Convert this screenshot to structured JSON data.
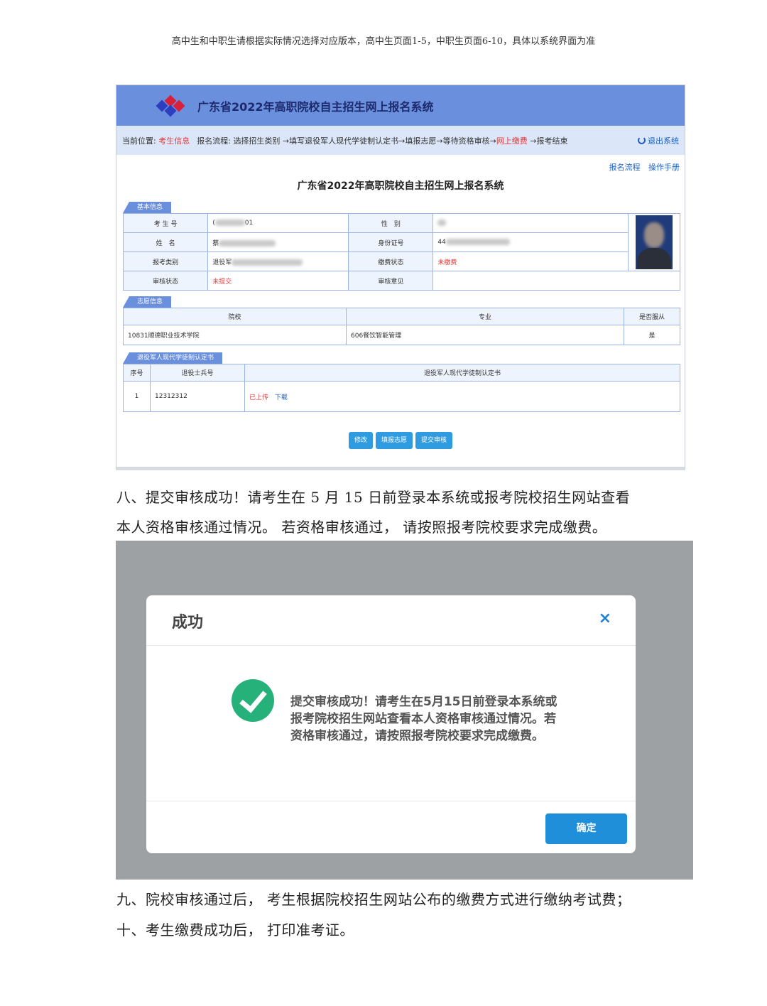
{
  "top_note": "高中生和中职生请根据实际情况选择对应版本，高中生页面1-5，中职生页面6-10，具体以系统界面为准",
  "system": {
    "title": "广东省2022年高职院校自主招生网上报名系统",
    "nav": {
      "position_label": "当前位置:",
      "position_value": "考生信息",
      "flow_label": "报名流程:",
      "flow_steps": "选择招生类别 →填写退役军人现代学徒制认定书→填报志愿→等待资格审核→",
      "flow_payment": "网上缴费",
      "flow_end": " →报考结束",
      "logout": "退出系统"
    },
    "links": [
      "报名流程",
      "操作手册"
    ],
    "page_heading": "广东省2022年高职院校自主招生网上报名系统",
    "basic": {
      "section": "基本信息",
      "labels": [
        "考 生 号",
        "性　别",
        "姓　名",
        "身份证号",
        "报考类别",
        "缴费状态",
        "审核状态",
        "审核意见"
      ],
      "exam_no_start": "(",
      "exam_no_end": "01",
      "name_start": "蔡",
      "id_start": "44",
      "category_start": "退役军",
      "pay_status": "未缴费",
      "review_status": "未提交"
    },
    "wish": {
      "section": "志愿信息",
      "headers": [
        "院校",
        "专业",
        "是否服从"
      ],
      "school": "10831顺德职业技术学院",
      "major": "606餐饮智能管理",
      "obey": "是"
    },
    "cert": {
      "section": "退役军人现代学徒制认定书",
      "headers": [
        "序号",
        "退役士兵号",
        "退役军人现代学徒制认定书"
      ],
      "index": "1",
      "soldier_no": "12312312",
      "uploaded": "已上传",
      "download": "下载"
    },
    "buttons": [
      "修改",
      "填报志愿",
      "提交审核"
    ]
  },
  "para8_line1": "八、提交审核成功！请考生在 5 月 15 日前登录本系统或报考院校招生网站查看",
  "para8_line2": "本人资格审核通过情况。 若资格审核通过， 请按照报考院校要求完成缴费。",
  "dialog": {
    "title": "成功",
    "close": "×",
    "message": "提交审核成功！请考生在5月15日前登录本系统或报考院校招生网站查看本人资格审核通过情况。若资格审核通过，请按照报考院校要求完成缴费。",
    "ok": "确定"
  },
  "para9": "九、院校审核通过后， 考生根据院校招生网站公布的缴费方式进行缴纳考试费；",
  "para10": "十、考生缴费成功后， 打印准考证。"
}
